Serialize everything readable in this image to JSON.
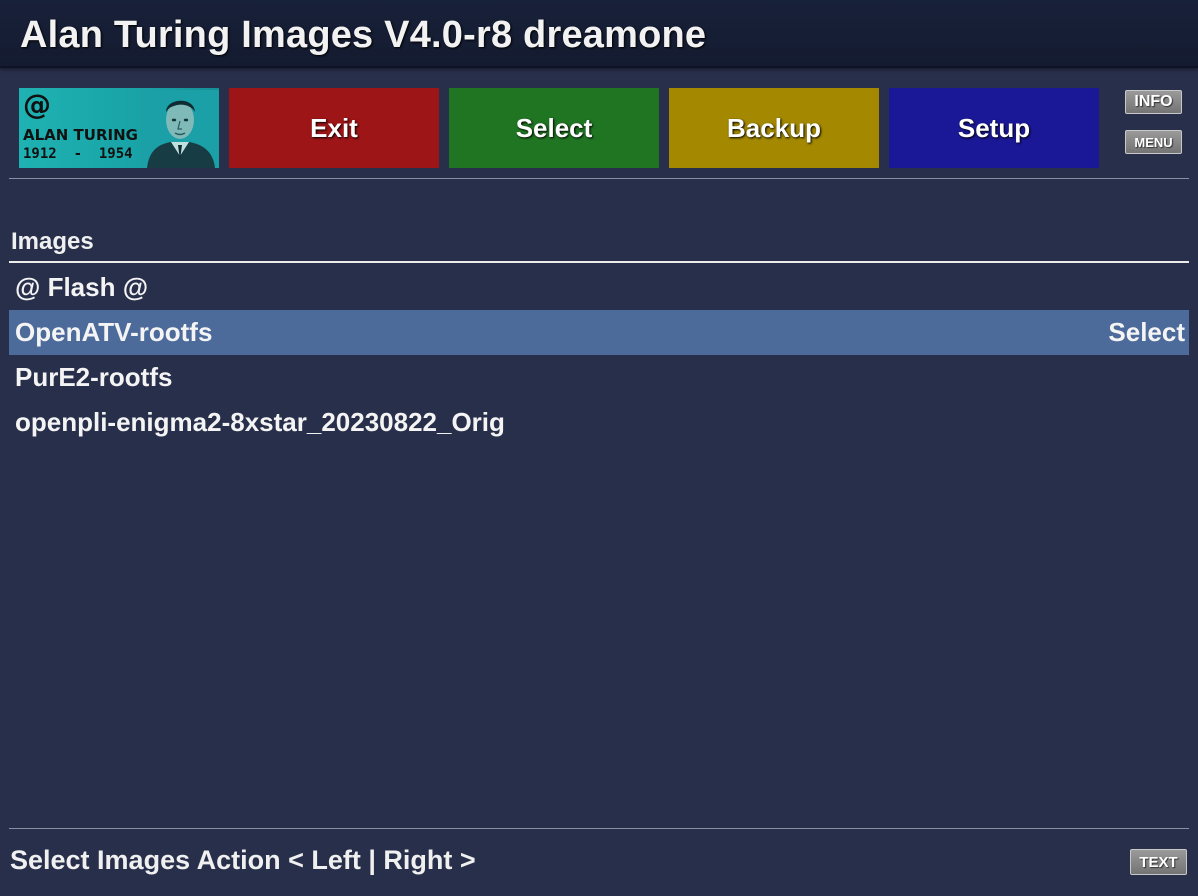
{
  "title": "Alan Turing Images V4.0-r8 dreamone",
  "logo": {
    "at": "@",
    "name": "ALAN TURING",
    "years": "1912  -  1954"
  },
  "color_keys": {
    "red": {
      "label": "Exit",
      "color": "#9d1517"
    },
    "green": {
      "label": "Select",
      "color": "#207523"
    },
    "yellow": {
      "label": "Backup",
      "color": "#a38800"
    },
    "blue": {
      "label": "Setup",
      "color": "#1a1896"
    }
  },
  "side_keys": {
    "info": "INFO",
    "menu": "MENU"
  },
  "section": {
    "title": "Images"
  },
  "list": [
    {
      "label": "@ Flash @",
      "action": ""
    },
    {
      "label": "OpenATV-rootfs",
      "action": "Select",
      "selected": true
    },
    {
      "label": "PurE2-rootfs",
      "action": ""
    },
    {
      "label": "openpli-enigma2-8xstar_20230822_Orig",
      "action": ""
    }
  ],
  "footer": {
    "status": "Select Images Action < Left | Right >",
    "text_key": "TEXT"
  },
  "colors": {
    "background": "#282f4b",
    "selection": "#4d6b9a",
    "titlebar": "#18213a"
  }
}
